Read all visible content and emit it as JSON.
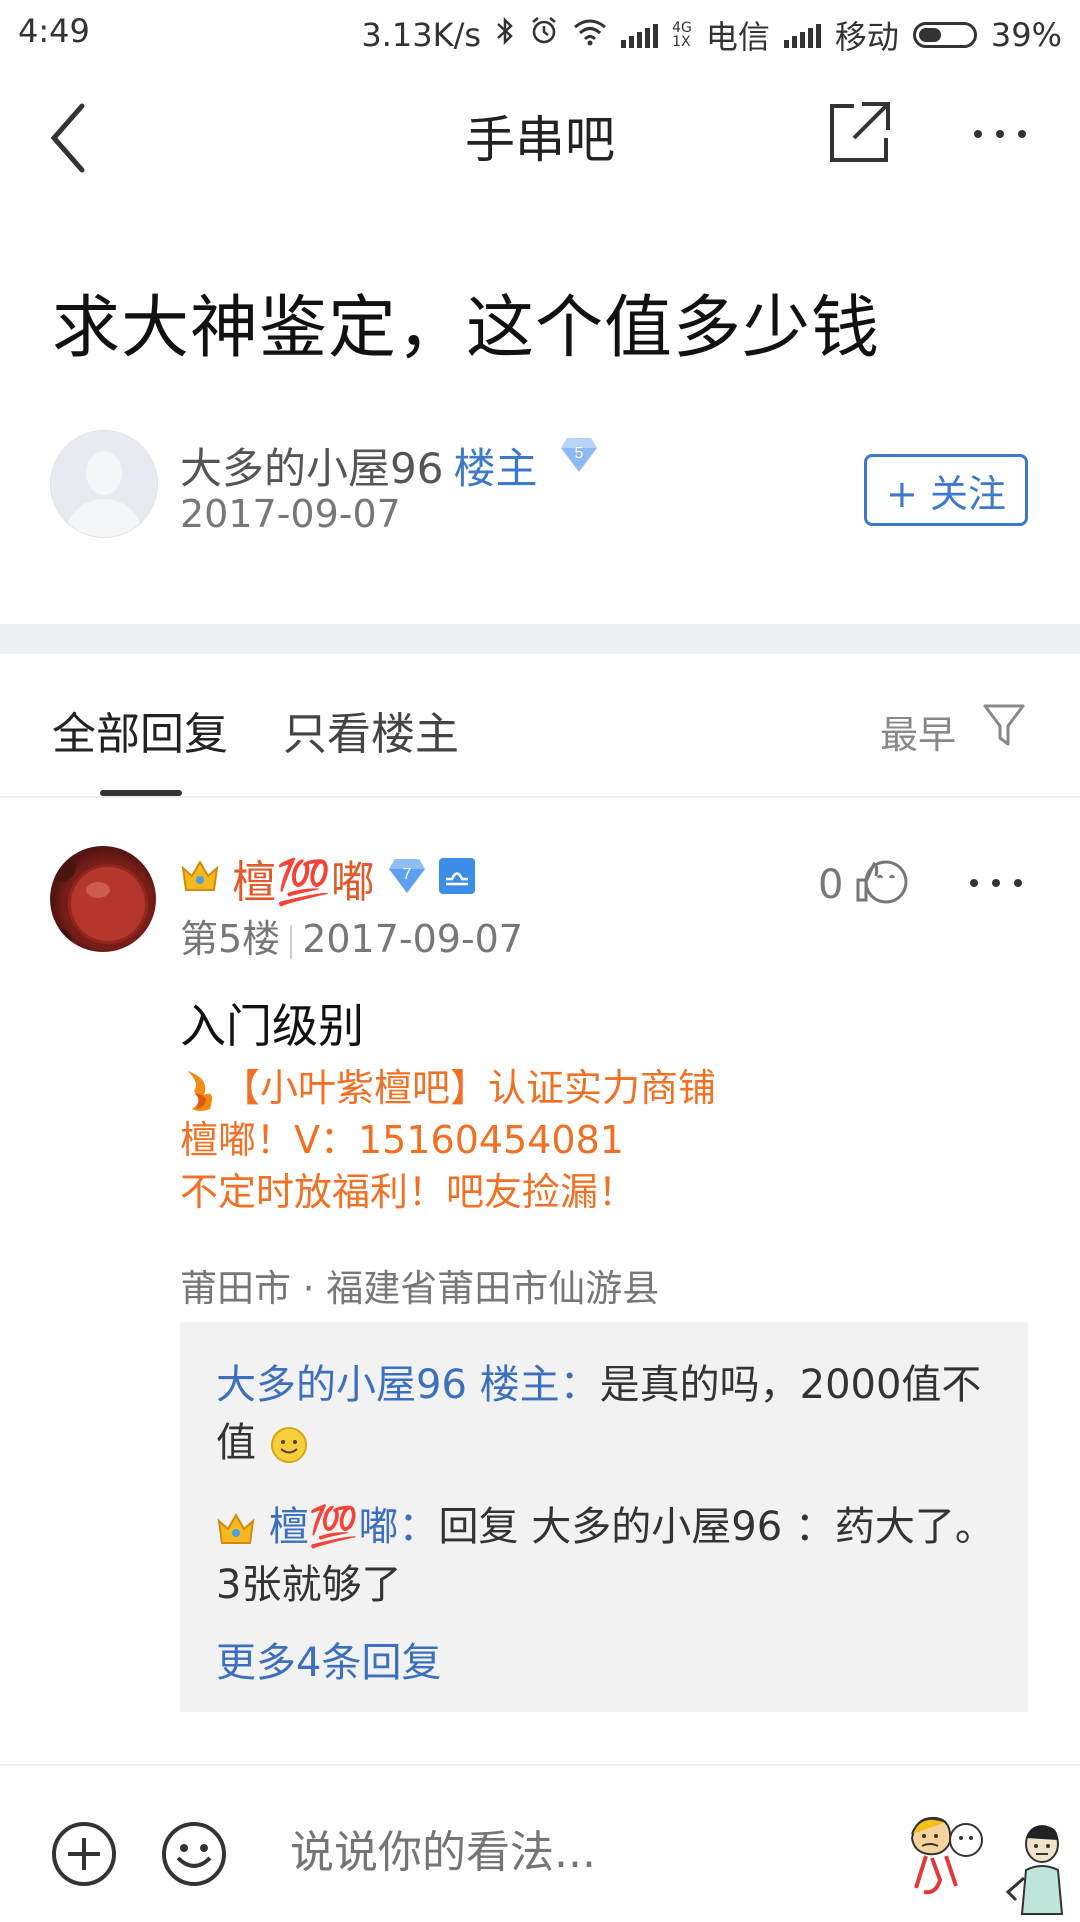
{
  "status_bar": {
    "time": "4:49",
    "speed": "3.13K/s",
    "net_4g": "4G",
    "net_1x": "1X",
    "carrier1": "电信",
    "carrier2": "移动",
    "battery": "39%"
  },
  "nav": {
    "title": "手串吧"
  },
  "post": {
    "title": "求大神鉴定，这个值多少钱",
    "author": "大多的小屋96",
    "op_tag": "楼主",
    "level": "5",
    "date": "2017-09-07",
    "follow_label": "+ 关注"
  },
  "tabs": {
    "all": "全部回复",
    "op_only": "只看楼主",
    "sort": "最早"
  },
  "reply": {
    "username_prefix": "檀",
    "username_emoji": "💯",
    "username_suffix": "嘟",
    "level": "7",
    "floor": "第5楼",
    "date": "2017-09-07",
    "likes": "0",
    "content": "入门级别",
    "tail_lines": [
      "【小叶紫檀吧】认证实力商铺",
      "檀嘟！V：15160454081",
      "不定时放福利！吧友捡漏！"
    ],
    "location": "莆田市 · 福建省莆田市仙游县",
    "sub_replies": [
      {
        "author": "大多的小屋96 楼主",
        "text": "是真的吗，2000值不值"
      },
      {
        "author_prefix": "檀",
        "author_emoji": "💯",
        "author_suffix": "嘟",
        "text": "回复 大多的小屋96 ：药大了。3张就够了"
      }
    ],
    "more_replies": "更多4条回复"
  },
  "bottom": {
    "placeholder": "说说你的看法..."
  },
  "colors": {
    "accent_blue": "#3c78cc",
    "name_orange": "#e2592a",
    "tail_orange": "#f27023"
  }
}
